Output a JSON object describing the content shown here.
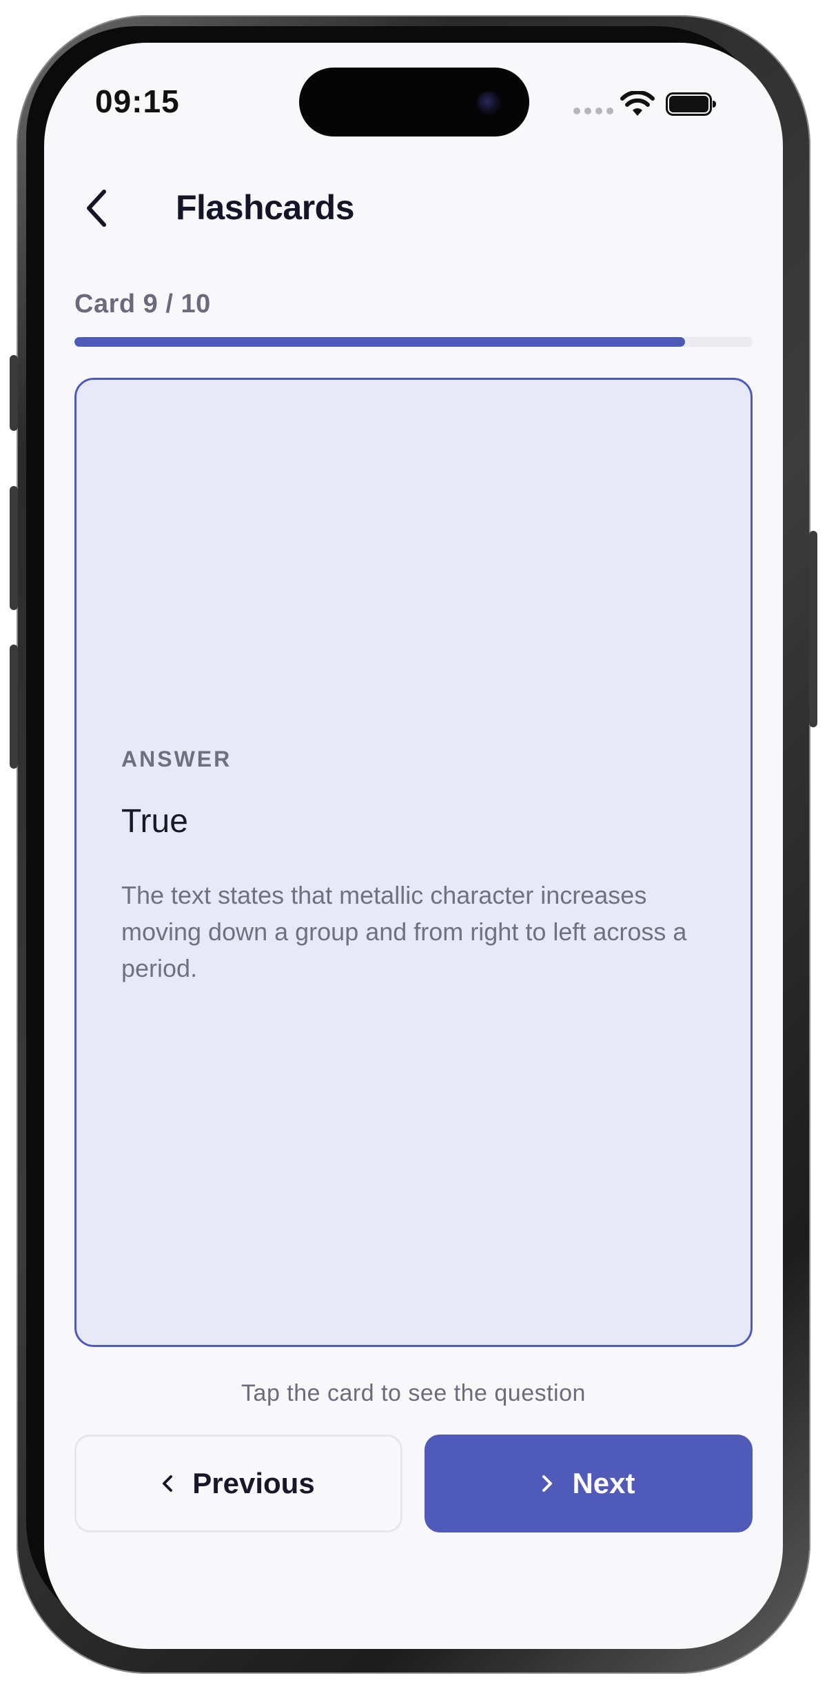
{
  "status_bar": {
    "time": "09:15"
  },
  "header": {
    "title": "Flashcards",
    "back_icon": "chevron-left-icon"
  },
  "progress": {
    "label": "Card 9 / 10",
    "fraction": 0.9
  },
  "card": {
    "side_label": "ANSWER",
    "answer": "True",
    "explanation": "The text states that metallic character increases moving down a group and from right to left across a period."
  },
  "hint": "Tap the card to see the question",
  "buttons": {
    "previous_label": "Previous",
    "next_label": "Next"
  },
  "colors": {
    "accent": "#505ab9",
    "card_background": "#e8e9f6",
    "screen_background": "#f8f8fb"
  }
}
